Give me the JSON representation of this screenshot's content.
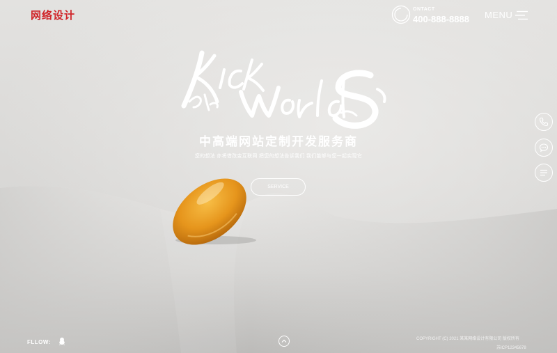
{
  "header": {
    "logo_text": "网络设计",
    "contact_label": "ONTACT",
    "contact_number": "400-888-8888",
    "menu_label": "MENU"
  },
  "hero": {
    "tagline": "中高端网站定制开发服务商",
    "subline": "您的想法 亦将借改变互联网 把您的想法告诉我们 我们能够与您一起实现它",
    "service_button": "SERVICE"
  },
  "sidebar": {
    "buttons": [
      {
        "icon": "phone-icon"
      },
      {
        "icon": "chat-icon"
      },
      {
        "icon": "list-icon"
      }
    ]
  },
  "footer": {
    "follow_label": "FLLOW:",
    "copyright": "COPYRIGHT (C) 2021 某某网络设计有限公司 版权所有",
    "icp": "苏ICP12345678"
  },
  "colors": {
    "brand_red": "#d0252a",
    "orange": "#e6951c",
    "background": "#dcdbd9"
  }
}
